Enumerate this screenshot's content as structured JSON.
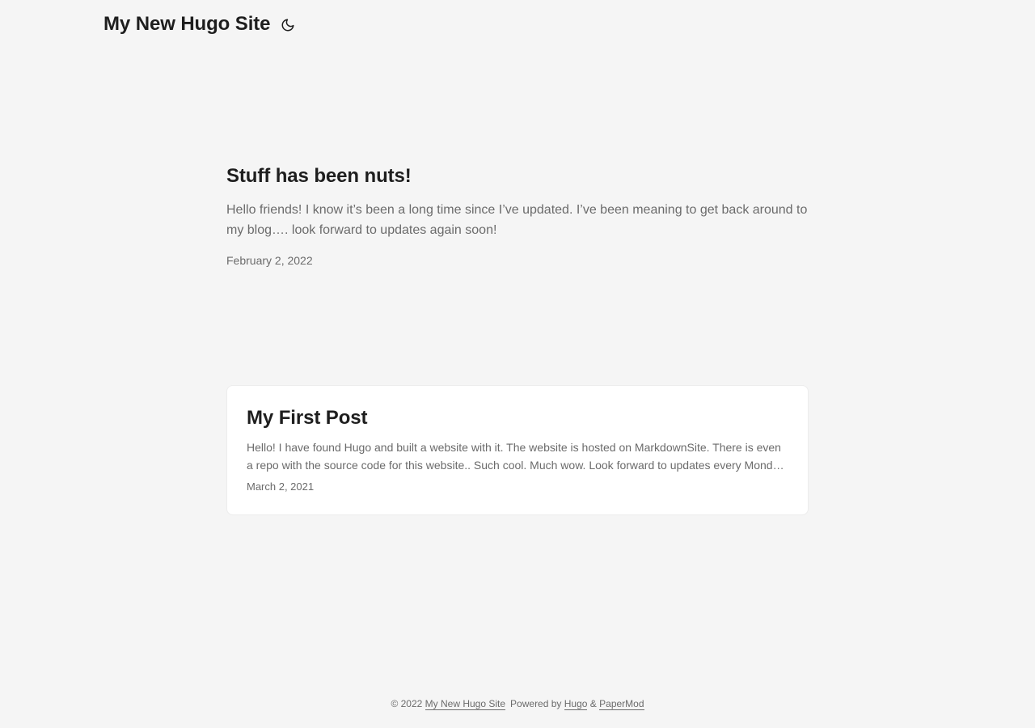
{
  "header": {
    "site_title": "My New Hugo Site",
    "theme_toggle_icon": "moon-icon"
  },
  "first_entry": {
    "title": "Stuff has been nuts!",
    "summary": "Hello friends! I know it’s been a long time since I’ve updated. I’ve been meaning to get back around to my blog…. look forward to updates again soon!",
    "date": "February 2, 2022"
  },
  "posts": [
    {
      "title": "My First Post",
      "summary": "Hello! I have found Hugo and built a website with it. The website is hosted on MarkdownSite. There is even a repo with the source code for this website.. Such cool. Much wow. Look forward to updates every Mond…",
      "date": "March 2, 2021"
    }
  ],
  "footer": {
    "copyright": "© 2022",
    "site_link": "My New Hugo Site",
    "powered_by": "Powered by",
    "hugo_link": "Hugo",
    "ampersand": "&",
    "papermod_link": "PaperMod"
  },
  "colors": {
    "background": "#f5f5f5",
    "card": "#ffffff",
    "primary_text": "#1e1e1e",
    "secondary_text": "#6b6b6b",
    "border": "#ececec"
  }
}
